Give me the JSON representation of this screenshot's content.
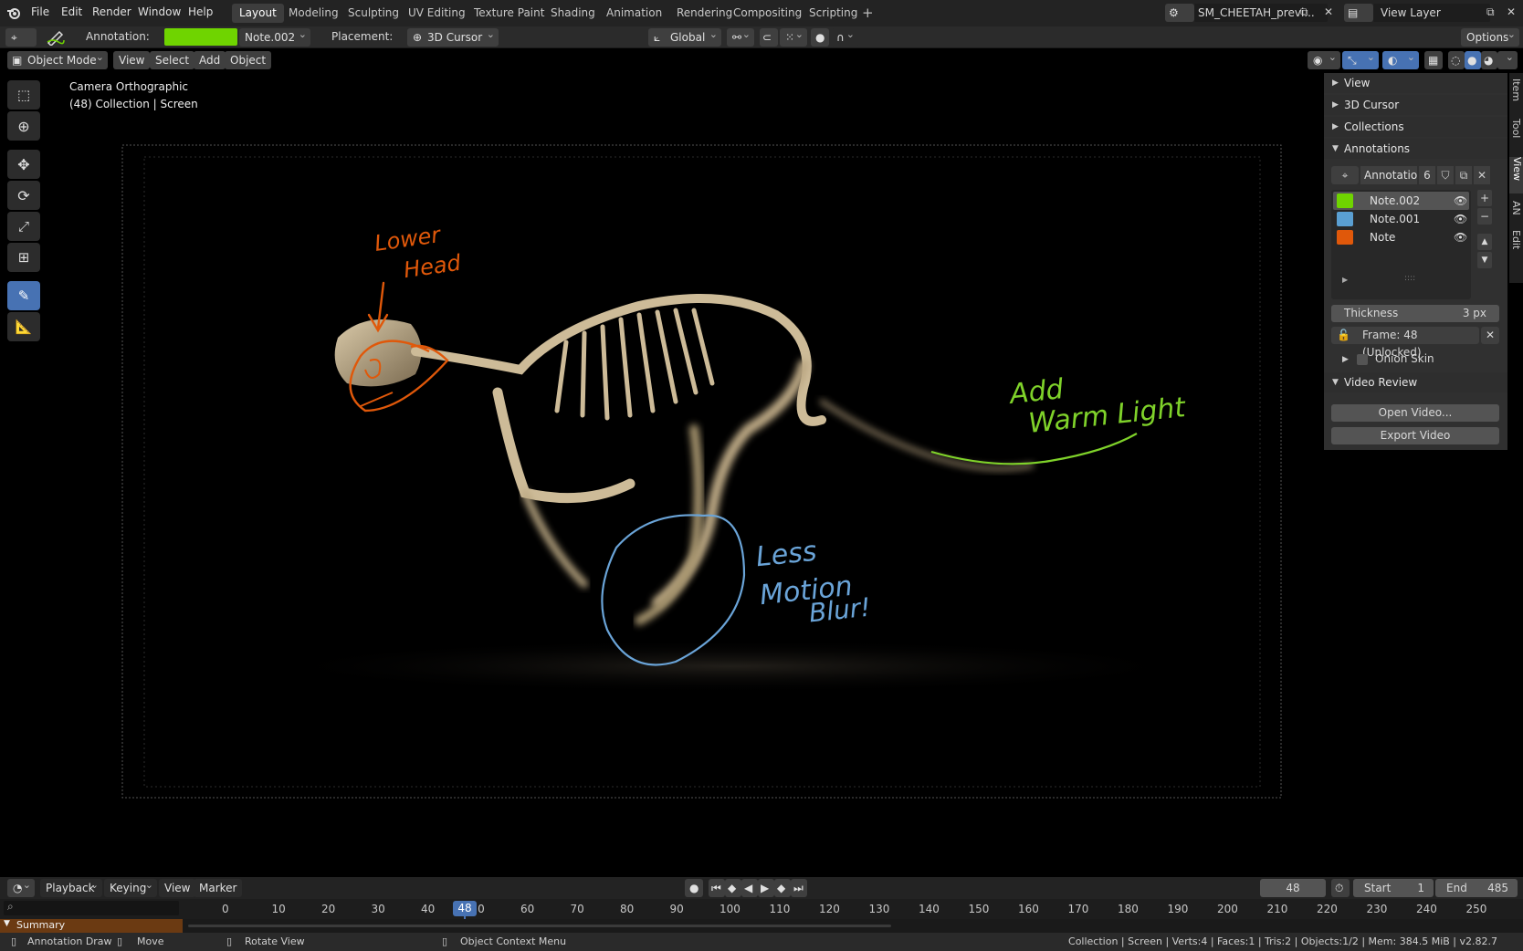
{
  "menu": [
    "File",
    "Edit",
    "Render",
    "Window",
    "Help"
  ],
  "workspaces": [
    "Layout",
    "Modeling",
    "Sculpting",
    "UV Editing",
    "Texture Paint",
    "Shading",
    "Animation",
    "Rendering",
    "Compositing",
    "Scripting"
  ],
  "active_workspace": "Layout",
  "scene_name": "SM_CHEETAH_previ...",
  "view_layer": "View Layer",
  "tool_header": {
    "annotation_label": "Annotation:",
    "annotation_layer": "Note.002",
    "annotation_color": "#6fd400",
    "placement_label": "Placement:",
    "placement_value": "3D Cursor",
    "orientation": "Global",
    "options": "Options"
  },
  "viewport_header": {
    "mode": "Object Mode",
    "menus": [
      "View",
      "Select",
      "Add",
      "Object"
    ]
  },
  "viewport": {
    "camera_label": "Camera Orthographic",
    "collection_label": "(48) Collection | Screen"
  },
  "annotations_drawn": {
    "orange": [
      "Lower",
      "Head"
    ],
    "blue": [
      "Less",
      "Motion",
      "Blur!"
    ],
    "green": [
      "Add",
      "Warm Light"
    ],
    "colors": {
      "orange": "#e0580a",
      "blue": "#6aa4d8",
      "green": "#7fd22a"
    }
  },
  "n_panel": {
    "sections": [
      "View",
      "3D Cursor",
      "Collections",
      "Annotations"
    ],
    "annotation_datablock": "Annotatio...",
    "user_count": "6",
    "layers": [
      {
        "name": "Note.002",
        "color": "#6fd400"
      },
      {
        "name": "Note.001",
        "color": "#5a9fd2"
      },
      {
        "name": "Note",
        "color": "#e0580a"
      }
    ],
    "thickness_label": "Thickness",
    "thickness_value": "3 px",
    "frame_status": "Frame: 48 (Unlocked)",
    "onion_skin": "Onion Skin",
    "video_review": "Video Review",
    "open_video": "Open Video...",
    "export_video": "Export Video",
    "tabs": [
      "Item",
      "Tool",
      "View",
      "AN",
      "Edit"
    ]
  },
  "timeline": {
    "menus": [
      "Playback",
      "Keying",
      "View",
      "Marker"
    ],
    "current_frame": "48",
    "start_label": "Start",
    "start_value": "1",
    "end_label": "End",
    "end_value": "485",
    "ticks": [
      "0",
      "10",
      "20",
      "30",
      "40",
      "50",
      "60",
      "70",
      "80",
      "90",
      "100",
      "110",
      "120",
      "130",
      "140",
      "150",
      "160",
      "170",
      "180",
      "190",
      "200",
      "210",
      "220",
      "230",
      "240",
      "250"
    ],
    "summary": "Summary"
  },
  "statusbar": {
    "annotation_draw": "Annotation Draw",
    "move": "Move",
    "rotate_view": "Rotate View",
    "context_menu": "Object Context Menu",
    "stats": "Collection | Screen | Verts:4 | Faces:1 | Tris:2 | Objects:1/2 | Mem: 384.5 MiB | v2.82.7"
  }
}
